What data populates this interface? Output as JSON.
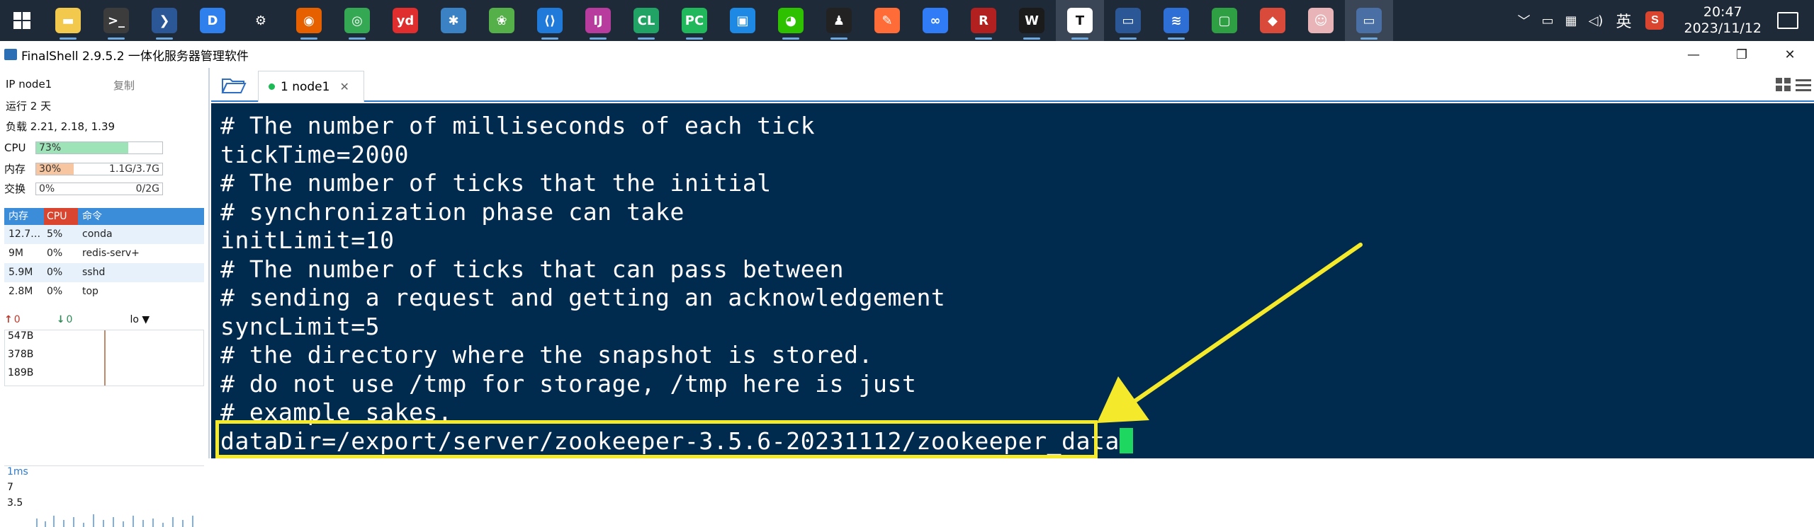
{
  "taskbar": {
    "apps": [
      {
        "name": "file-explorer-icon",
        "glyph": "▬",
        "color": "#f2c94c"
      },
      {
        "name": "terminal-app-icon",
        "glyph": ">_",
        "color": "#3c3c3c"
      },
      {
        "name": "powershell-icon",
        "glyph": "❯",
        "color": "#2b5797"
      },
      {
        "name": "app-blue-icon",
        "glyph": "D",
        "color": "#2f80ed"
      },
      {
        "name": "settings-icon",
        "glyph": "⚙",
        "color": "#1f2a38"
      },
      {
        "name": "firefox-icon",
        "glyph": "◉",
        "color": "#e66000"
      },
      {
        "name": "chrome-icon",
        "glyph": "◎",
        "color": "#34a853"
      },
      {
        "name": "youdao-icon",
        "glyph": "yd",
        "color": "#e02d2d"
      },
      {
        "name": "app-gear-blue-icon",
        "glyph": "✱",
        "color": "#3b82c4"
      },
      {
        "name": "app-green-icon",
        "glyph": "❀",
        "color": "#56b04a"
      },
      {
        "name": "vscode-icon",
        "glyph": "⟨⟩",
        "color": "#1f7ad9"
      },
      {
        "name": "intellij-icon",
        "glyph": "IJ",
        "color": "#b83b9e"
      },
      {
        "name": "clion-icon",
        "glyph": "CL",
        "color": "#21a366"
      },
      {
        "name": "pycharm-icon",
        "glyph": "PC",
        "color": "#21b85b"
      },
      {
        "name": "app-window-icon",
        "glyph": "▣",
        "color": "#1e88e5"
      },
      {
        "name": "wechat-icon",
        "glyph": "◕",
        "color": "#2dc100"
      },
      {
        "name": "qq-icon",
        "glyph": "♟",
        "color": "#222222"
      },
      {
        "name": "postman-icon",
        "glyph": "✎",
        "color": "#ff6c37"
      },
      {
        "name": "baidu-netdisk-icon",
        "glyph": "∞",
        "color": "#2f7cf6"
      },
      {
        "name": "app-red-round-icon",
        "glyph": "R",
        "color": "#b32020"
      },
      {
        "name": "wps-icon",
        "glyph": "W",
        "color": "#1b1b1b"
      },
      {
        "name": "typora-icon",
        "glyph": "T",
        "color": "#ffffff"
      },
      {
        "name": "remote-desktop-icon",
        "glyph": "▭",
        "color": "#2b5797"
      },
      {
        "name": "app-feather-icon",
        "glyph": "≋",
        "color": "#2e6fd6"
      },
      {
        "name": "app-screen-green-icon",
        "glyph": "▢",
        "color": "#2ea043"
      },
      {
        "name": "app-kite-icon",
        "glyph": "◆",
        "color": "#d94a3a"
      },
      {
        "name": "avatar-app-icon",
        "glyph": "☺",
        "color": "#e8b4b8"
      },
      {
        "name": "finalshell-taskbar-icon",
        "glyph": "▭",
        "color": "#4a6fa5"
      }
    ],
    "tray": {
      "chevron": "﹀",
      "battery": "▭",
      "network": "▦",
      "volume": "◁)",
      "language": "英",
      "ime": "S"
    },
    "clock": {
      "time": "20:47",
      "date": "2023/11/12"
    }
  },
  "window": {
    "title": "FinalShell 2.9.5.2 一体化服务器管理软件",
    "controls": {
      "minimize": "—",
      "maximize": "❐",
      "close": "✕"
    }
  },
  "sidebar": {
    "ip_label": "IP node1",
    "copy": "复制",
    "uptime": "运行 2 天",
    "load": "负载 2.21, 2.18, 1.39",
    "cpu": {
      "label": "CPU",
      "percent": "73%",
      "fill": 0.73,
      "color": "#9ee2b8"
    },
    "mem": {
      "label": "内存",
      "percent": "30%",
      "value": "1.1G/3.7G",
      "fill": 0.3,
      "color": "#f7c59f"
    },
    "swap": {
      "label": "交换",
      "percent": "0%",
      "value": "0/2G",
      "fill": 0.0,
      "color": "#cccccc"
    },
    "proc_headers": [
      "内存",
      "CPU",
      "命令"
    ],
    "processes": [
      [
        "12.7…",
        "5%",
        "conda"
      ],
      [
        "9M",
        "0%",
        "redis-serv+"
      ],
      [
        "5.9M",
        "0%",
        "sshd"
      ],
      [
        "2.8M",
        "0%",
        "top"
      ]
    ],
    "net": {
      "up": "0",
      "down": "0",
      "iface": "lo ▼",
      "labels": [
        "547B",
        "378B",
        "189B"
      ]
    },
    "ping": {
      "labels": [
        "1ms",
        "7",
        "3.5"
      ]
    }
  },
  "tabs": [
    {
      "label": "1 node1",
      "close": "✕"
    }
  ],
  "terminal": {
    "lines": [
      "# The number of milliseconds of each tick",
      "tickTime=2000",
      "# The number of ticks that the initial",
      "# synchronization phase can take",
      "initLimit=10",
      "# The number of ticks that can pass between",
      "# sending a request and getting an acknowledgement",
      "syncLimit=5",
      "# the directory where the snapshot is stored.",
      "# do not use /tmp for storage, /tmp here is just",
      "# example sakes.",
      "dataDir=/export/server/zookeeper-3.5.6-20231112/zookeeper_data"
    ],
    "bg": "#012a4f",
    "annotation_color": "#f4e92b"
  }
}
